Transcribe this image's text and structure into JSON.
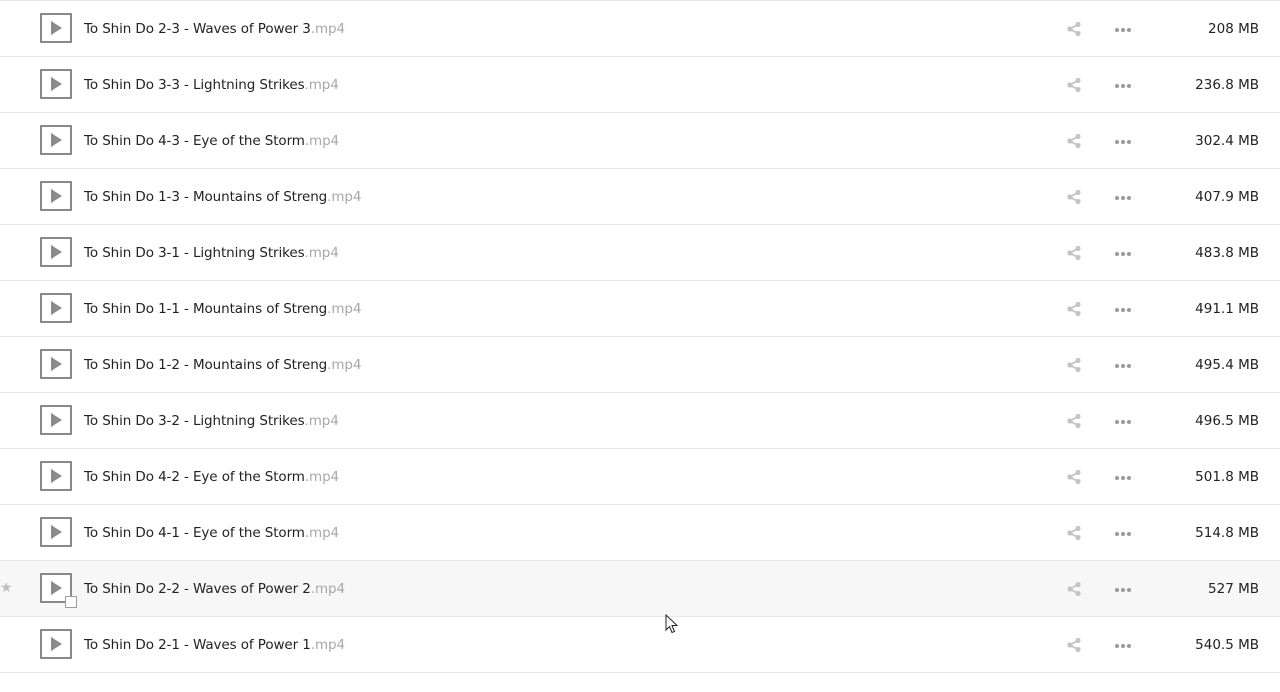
{
  "files": [
    {
      "name": "To Shin Do 2-3 - Waves of Power 3",
      "ext": ".mp4",
      "size": "208 MB"
    },
    {
      "name": "To Shin Do 3-3 - Lightning Strikes",
      "ext": ".mp4",
      "size": "236.8 MB"
    },
    {
      "name": "To Shin Do 4-3 - Eye of the Storm",
      "ext": ".mp4",
      "size": "302.4 MB"
    },
    {
      "name": "To Shin Do 1-3 - Mountains of Streng",
      "ext": ".mp4",
      "size": "407.9 MB"
    },
    {
      "name": "To Shin Do 3-1 - Lightning Strikes",
      "ext": ".mp4",
      "size": "483.8 MB"
    },
    {
      "name": "To Shin Do 1-1 - Mountains of Streng",
      "ext": ".mp4",
      "size": "491.1 MB"
    },
    {
      "name": "To Shin Do 1-2 - Mountains of Streng",
      "ext": ".mp4",
      "size": "495.4 MB"
    },
    {
      "name": "To Shin Do 3-2 - Lightning Strikes",
      "ext": ".mp4",
      "size": "496.5 MB"
    },
    {
      "name": "To Shin Do 4-2 - Eye of the Storm",
      "ext": ".mp4",
      "size": "501.8 MB"
    },
    {
      "name": "To Shin Do 4-1 - Eye of the Storm",
      "ext": ".mp4",
      "size": "514.8 MB"
    },
    {
      "name": "To Shin Do 2-2 - Waves of Power 2",
      "ext": ".mp4",
      "size": "527 MB",
      "hovered": true
    },
    {
      "name": "To Shin Do 2-1 - Waves of Power 1",
      "ext": ".mp4",
      "size": "540.5 MB"
    }
  ],
  "icons": {
    "thumbnail": "video-play-icon",
    "share": "share-icon",
    "more": "more-options-icon",
    "favorite": "star-icon",
    "cursor": "mouse-pointer-icon"
  },
  "colors": {
    "text": "#222222",
    "extension": "#a8a8a8",
    "icon": "#bdbdbd",
    "divider": "#e8e8e8",
    "hover_background": "#f7f7f7"
  }
}
